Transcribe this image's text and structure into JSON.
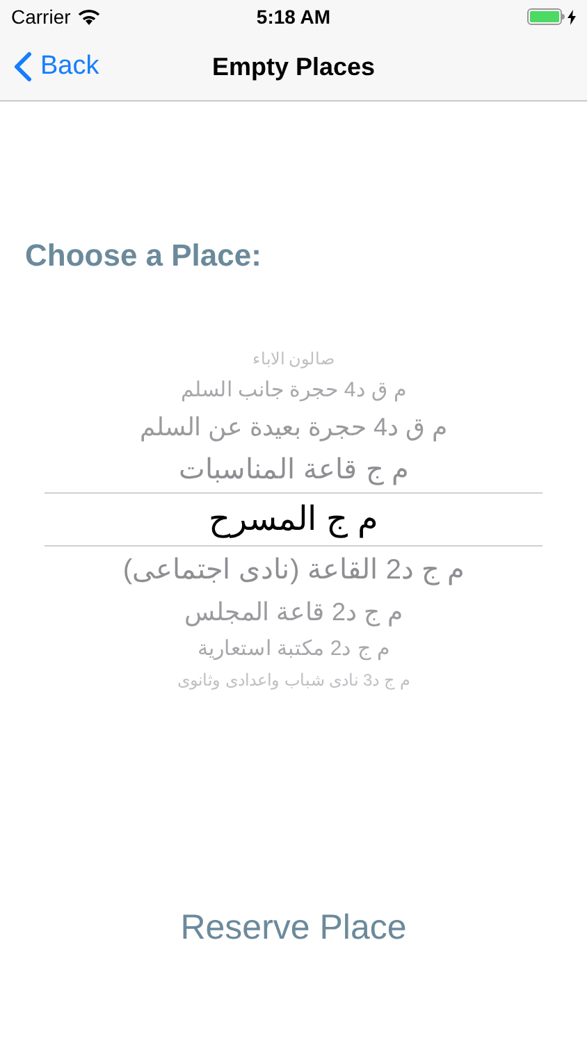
{
  "status_bar": {
    "carrier": "Carrier",
    "time": "5:18 AM"
  },
  "nav_bar": {
    "back": "Back",
    "title": "Empty Places"
  },
  "prompt": "Choose a Place:",
  "picker": {
    "items": [
      {
        "label": "صالون الاباء",
        "selected": false
      },
      {
        "label": "م ق د4 حجرة جانب السلم",
        "selected": false
      },
      {
        "label": "م ق د4 حجرة بعيدة عن السلم",
        "selected": false
      },
      {
        "label": "م ج قاعة المناسبات",
        "selected": false
      },
      {
        "label": "م ج المسرح",
        "selected": true
      },
      {
        "label": "م ج د2 القاعة (نادى اجتماعى)",
        "selected": false
      },
      {
        "label": "م ج د2 قاعة المجلس",
        "selected": false
      },
      {
        "label": "م ج د2 مكتبة استعارية",
        "selected": false
      },
      {
        "label": "م ج د3 نادى شباب واعدادى وثانوى",
        "selected": false
      }
    ]
  },
  "reserve_button": "Reserve Place"
}
